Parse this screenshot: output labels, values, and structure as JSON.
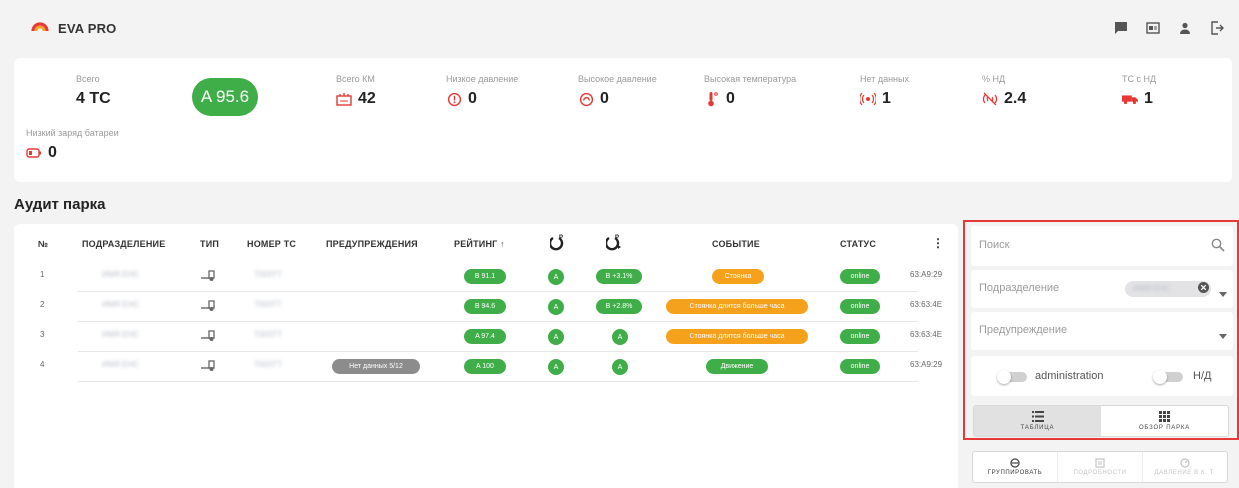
{
  "app": {
    "name": "EVA PRO"
  },
  "colors": {
    "accent_green": "#3fae49",
    "accent_orange": "#f5a11c",
    "danger": "#e53935",
    "grey_pill": "#8c8c8c"
  },
  "header_icons": [
    "chat-icon",
    "id-card-icon",
    "user-icon",
    "logout-icon"
  ],
  "stats": {
    "total": {
      "label": "Всего",
      "value": "4 ТС"
    },
    "rating": "A 95.6",
    "total_km": {
      "label": "Всего КМ",
      "value": "42"
    },
    "low_pressure": {
      "label": "Низкое давление",
      "value": "0"
    },
    "high_pressure": {
      "label": "Высокое давление",
      "value": "0"
    },
    "high_temp": {
      "label": "Высокая температура",
      "value": "0"
    },
    "no_data": {
      "label": "Нет данных",
      "value": "1"
    },
    "pct_nd": {
      "label": "% НД",
      "value": "2.4"
    },
    "vehicles_nd": {
      "label": "ТС с НД",
      "value": "1"
    },
    "low_battery": {
      "label": "Низкий заряд батареи",
      "value": "0"
    }
  },
  "section": {
    "title": "Аудит парка"
  },
  "table": {
    "columns": {
      "num": "№",
      "division": "ПОДРАЗДЕЛЕНИЕ",
      "type": "ТИП",
      "plate": "НОМЕР ТС",
      "warnings": "ПРЕДУПРЕЖДЕНИЯ",
      "rating": "РЕЙТИНГ",
      "rating_sort": "↑",
      "event": "СОБЫТИЕ",
      "status": "СТАТУС",
      "more": "⋮"
    },
    "rows": [
      {
        "num": "1",
        "division": "ИМЯ ЕНС",
        "plate": "Т003ТТ",
        "warning": "",
        "rating": "B 91.1",
        "pressure": "A",
        "temp": "B +3.1%",
        "event": "Стоянка",
        "event_kind": "orange-short",
        "status": "online",
        "id": "63:A9:29"
      },
      {
        "num": "2",
        "division": "ИМЯ ЕНС",
        "plate": "Т003ТТ",
        "warning": "",
        "rating": "B 94.6",
        "pressure": "A",
        "temp": "B +2.8%",
        "event": "Стоянка длится больше часа",
        "event_kind": "orange-long",
        "status": "online",
        "id": "63:63:4E"
      },
      {
        "num": "3",
        "division": "ИМЯ ЕНС",
        "plate": "Т003ТТ",
        "warning": "",
        "rating": "A 97.4",
        "pressure": "A",
        "temp": "A",
        "event": "Стоянка длится больше часа",
        "event_kind": "orange-long",
        "status": "online",
        "id": "63:63:4E"
      },
      {
        "num": "4",
        "division": "ИМЯ ЕНС",
        "plate": "Т003ТТ",
        "warning": "Нет данных 5/12",
        "rating": "A 100",
        "pressure": "A",
        "temp": "A",
        "event": "Движение",
        "event_kind": "green",
        "status": "online",
        "id": "63:A9:29"
      }
    ]
  },
  "filters": {
    "search_placeholder": "Поиск",
    "division_placeholder": "Подразделение",
    "division_chip": "ИМЯ ЕНС",
    "warning_placeholder": "Предупреждение",
    "toggle_admin": "administration",
    "toggle_nd": "Н/Д",
    "view_table": "ТАБЛИЦА",
    "view_fleet": "ОБЗОР ПАРКА"
  },
  "actions": {
    "group": "ГРУППИРОВАТЬ",
    "details": "ПОДРОБНОСТИ",
    "pressure": "ДАВЛЕНИЕ В К. Т."
  }
}
